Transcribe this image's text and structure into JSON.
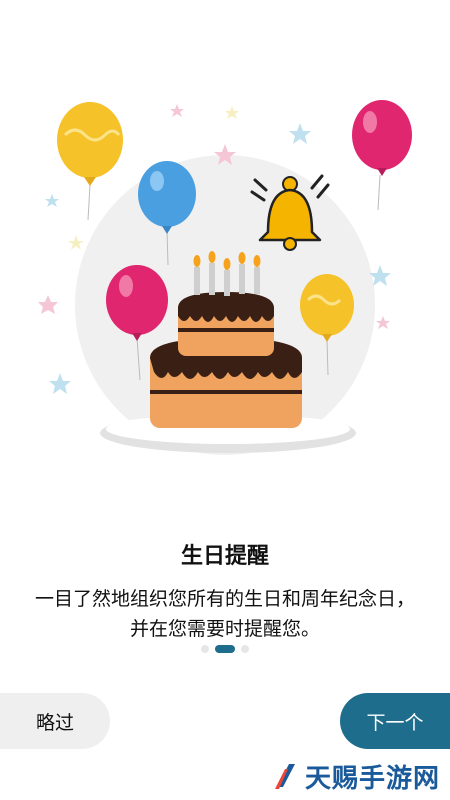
{
  "onboarding": {
    "title": "生日提醒",
    "description": "一目了然地组织您所有的生日和周年纪念日，并在您需要时提醒您。",
    "page_indicator": {
      "current": 2,
      "total": 3
    }
  },
  "buttons": {
    "skip_label": "略过",
    "next_label": "下一个"
  },
  "watermark": {
    "text": "天赐手游网"
  },
  "colors": {
    "accent": "#1f6d8d",
    "skip_bg": "#efefef"
  },
  "illustration": {
    "icons": [
      "birthday-cake-icon",
      "bell-icon",
      "balloon-icon",
      "star-icon"
    ]
  }
}
